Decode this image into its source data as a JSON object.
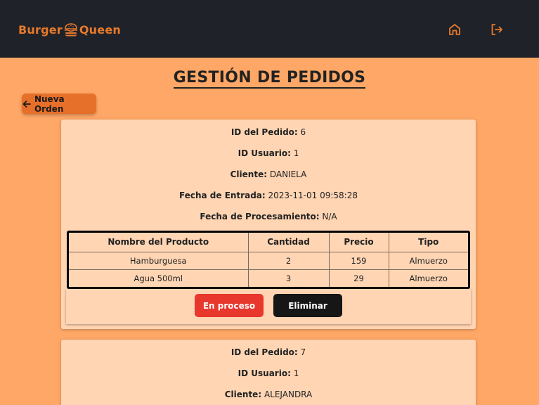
{
  "header": {
    "logo_left": "Burger",
    "logo_right": "Queen",
    "accent_color": "#e8792b",
    "icons": [
      "home-icon",
      "logout-icon"
    ]
  },
  "page": {
    "title": "GESTIÓN DE PEDIDOS",
    "new_order_label": "Nueva Orden"
  },
  "orders": [
    {
      "order_id_label": "ID del Pedido:",
      "order_id": "6",
      "user_id_label": "ID Usuario:",
      "user_id": "1",
      "client_label": "Cliente:",
      "client": "DANIELA",
      "entry_date_label": "Fecha de Entrada:",
      "entry_date": "2023-11-01 09:58:28",
      "processed_date_label": "Fecha de Procesamiento:",
      "processed_date": "N/A",
      "table": {
        "headers": [
          "Nombre del Producto",
          "Cantidad",
          "Precio",
          "Tipo"
        ],
        "rows": [
          [
            "Hamburguesa",
            "2",
            "159",
            "Almuerzo"
          ],
          [
            "Agua 500ml",
            "3",
            "29",
            "Almuerzo"
          ]
        ]
      },
      "status_button": "En proceso",
      "delete_button": "Eliminar"
    },
    {
      "order_id_label": "ID del Pedido:",
      "order_id": "7",
      "user_id_label": "ID Usuario:",
      "user_id": "1",
      "client_label": "Cliente:",
      "client": "ALEJANDRA"
    }
  ]
}
